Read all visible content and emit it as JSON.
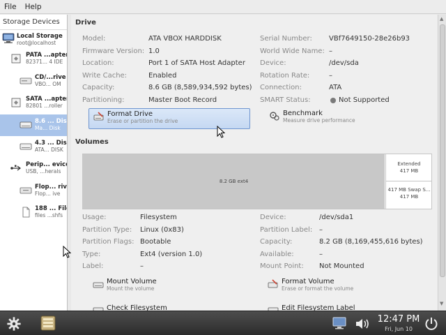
{
  "menu": {
    "file": "File",
    "help": "Help"
  },
  "sidebar": {
    "header": "Storage Devices",
    "local": {
      "title": "Local Storage",
      "subtitle": "root@localhost"
    },
    "items": [
      {
        "title": "PATA ...apter",
        "subtitle": "82371... 4 IDE"
      },
      {
        "title": "CD/...rive",
        "subtitle": "VBO... OM"
      },
      {
        "title": "SATA ...apter",
        "subtitle": "82801 ...roller"
      },
      {
        "title": "8.6 ... Disk",
        "subtitle": "Ma... Disk"
      },
      {
        "title": "4.3 ... Disk",
        "subtitle": "ATA... DISK"
      },
      {
        "title": "Perip... evices",
        "subtitle": "USB, ...herals"
      },
      {
        "title": "Flop... rive",
        "subtitle": "Flop... ive"
      },
      {
        "title": "188 ... File",
        "subtitle": "files ...shfs"
      }
    ]
  },
  "drive": {
    "section_title": "Drive",
    "left": [
      {
        "label": "Model:",
        "value": "ATA VBOX HARDDISK"
      },
      {
        "label": "Firmware Version:",
        "value": "1.0"
      },
      {
        "label": "Location:",
        "value": "Port 1 of SATA Host Adapter"
      },
      {
        "label": "Write Cache:",
        "value": "Enabled"
      },
      {
        "label": "Capacity:",
        "value": "8.6 GB (8,589,934,592 bytes)"
      },
      {
        "label": "Partitioning:",
        "value": "Master Boot Record"
      }
    ],
    "right": [
      {
        "label": "Serial Number:",
        "value": "VBf7649150-28e26b93"
      },
      {
        "label": "World Wide Name:",
        "value": "–"
      },
      {
        "label": "Device:",
        "value": "/dev/sda"
      },
      {
        "label": "Rotation Rate:",
        "value": "–"
      },
      {
        "label": "Connection:",
        "value": "ATA"
      },
      {
        "label": "SMART Status:",
        "value": "Not Supported"
      }
    ],
    "actions": {
      "format": {
        "title": "Format Drive",
        "desc": "Erase or partition the drive"
      },
      "benchmark": {
        "title": "Benchmark",
        "desc": "Measure drive performance"
      }
    }
  },
  "volumes": {
    "section_title": "Volumes",
    "bar": {
      "main": "8.2 GB ext4",
      "extended_line1": "Extended",
      "extended_line2": "417 MB",
      "swap_line1": "417 MB Swap S...",
      "swap_line2": "417 MB"
    },
    "left": [
      {
        "label": "Usage:",
        "value": "Filesystem"
      },
      {
        "label": "Partition Type:",
        "value": "Linux (0x83)"
      },
      {
        "label": "Partition Flags:",
        "value": "Bootable"
      },
      {
        "label": "Type:",
        "value": "Ext4 (version 1.0)"
      },
      {
        "label": "Label:",
        "value": "–"
      }
    ],
    "right": [
      {
        "label": "Device:",
        "value": "/dev/sda1"
      },
      {
        "label": "Partition Label:",
        "value": "–"
      },
      {
        "label": "Capacity:",
        "value": "8.2 GB (8,169,455,616 bytes)"
      },
      {
        "label": "Available:",
        "value": "–"
      },
      {
        "label": "Mount Point:",
        "value": "Not Mounted"
      }
    ],
    "actions": {
      "mount": {
        "title": "Mount Volume",
        "desc": "Mount the volume"
      },
      "format": {
        "title": "Format Volume",
        "desc": "Erase or format the volume"
      },
      "check": {
        "title": "Check Filesystem"
      },
      "edit_label": {
        "title": "Edit Filesystem Label"
      }
    }
  },
  "taskbar": {
    "time": "12:47 PM",
    "date": "Fri, Jun 10"
  },
  "colors": {
    "selection": "#a9c4ea",
    "highlight_border": "#6f95cf",
    "taskbar": "#2c2c2c"
  }
}
